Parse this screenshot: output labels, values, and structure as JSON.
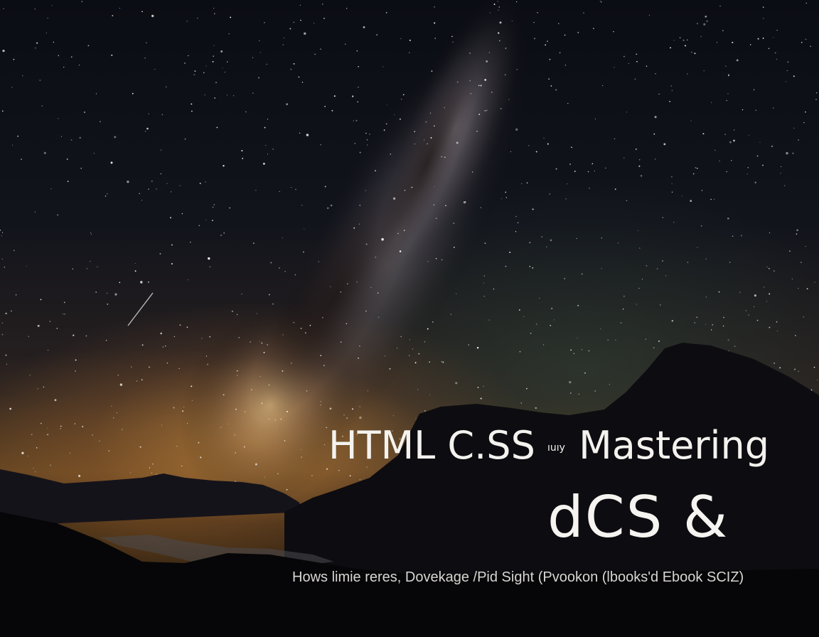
{
  "cover": {
    "title_part1": "HTML C.SS",
    "title_small": "ıuıy",
    "title_part2": "Mastering",
    "title_line2": "dCS &",
    "subtitle": "Hows limie reres, Dovekage /Pid Sight (Pvookon (lbooks'd Ebook SCIZ)"
  },
  "colors": {
    "sky_top": "#0b0d14",
    "horizon_glow": "#d69646",
    "text": "#f4f2ee"
  }
}
